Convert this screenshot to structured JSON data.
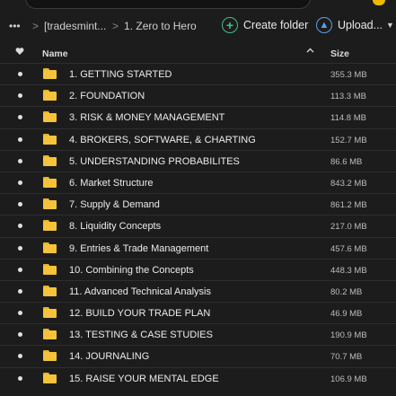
{
  "toolbar": {
    "more_label": "•••",
    "crumbs": [
      "[tradesmint....",
      "1. Zero to Hero"
    ],
    "separator": ">",
    "create_folder_label": "Create folder",
    "upload_label": "Upload..."
  },
  "header": {
    "name_label": "Name",
    "size_label": "Size",
    "sort_indicator": "^"
  },
  "files": [
    {
      "name": "1. GETTING STARTED",
      "size": "355.3 MB"
    },
    {
      "name": "2. FOUNDATION",
      "size": "113.3 MB"
    },
    {
      "name": "3. RISK & MONEY MANAGEMENT",
      "size": "114.8 MB"
    },
    {
      "name": "4. BROKERS, SOFTWARE, & CHARTING",
      "size": "152.7 MB"
    },
    {
      "name": "5. UNDERSTANDING PROBABILITES",
      "size": "86.6 MB"
    },
    {
      "name": "6. Market Structure",
      "size": "843.2 MB"
    },
    {
      "name": "7. Supply & Demand",
      "size": "861.2 MB"
    },
    {
      "name": "8. Liquidity Concepts",
      "size": "217.0 MB"
    },
    {
      "name": "9. Entries & Trade Management",
      "size": "457.6 MB"
    },
    {
      "name": "10. Combining the Concepts",
      "size": "448.3 MB"
    },
    {
      "name": "11. Advanced Technical Analysis",
      "size": "80.2 MB"
    },
    {
      "name": "12. BUILD YOUR TRADE PLAN",
      "size": "46.9 MB"
    },
    {
      "name": "13. TESTING & CASE STUDIES",
      "size": "190.9 MB"
    },
    {
      "name": "14. JOURNALING",
      "size": "70.7 MB"
    },
    {
      "name": "15. RAISE YOUR MENTAL EDGE",
      "size": "106.9 MB"
    }
  ],
  "icons": {
    "folder": "folder-icon",
    "create": "plus-circle-icon",
    "upload": "upload-circle-icon",
    "favorite": "heart-icon"
  },
  "colors": {
    "background": "#1c1c1c",
    "folder": "#f5c33b",
    "create_accent": "#3fbf87",
    "upload_accent": "#5aa2e6",
    "notification": "#f2b800"
  }
}
